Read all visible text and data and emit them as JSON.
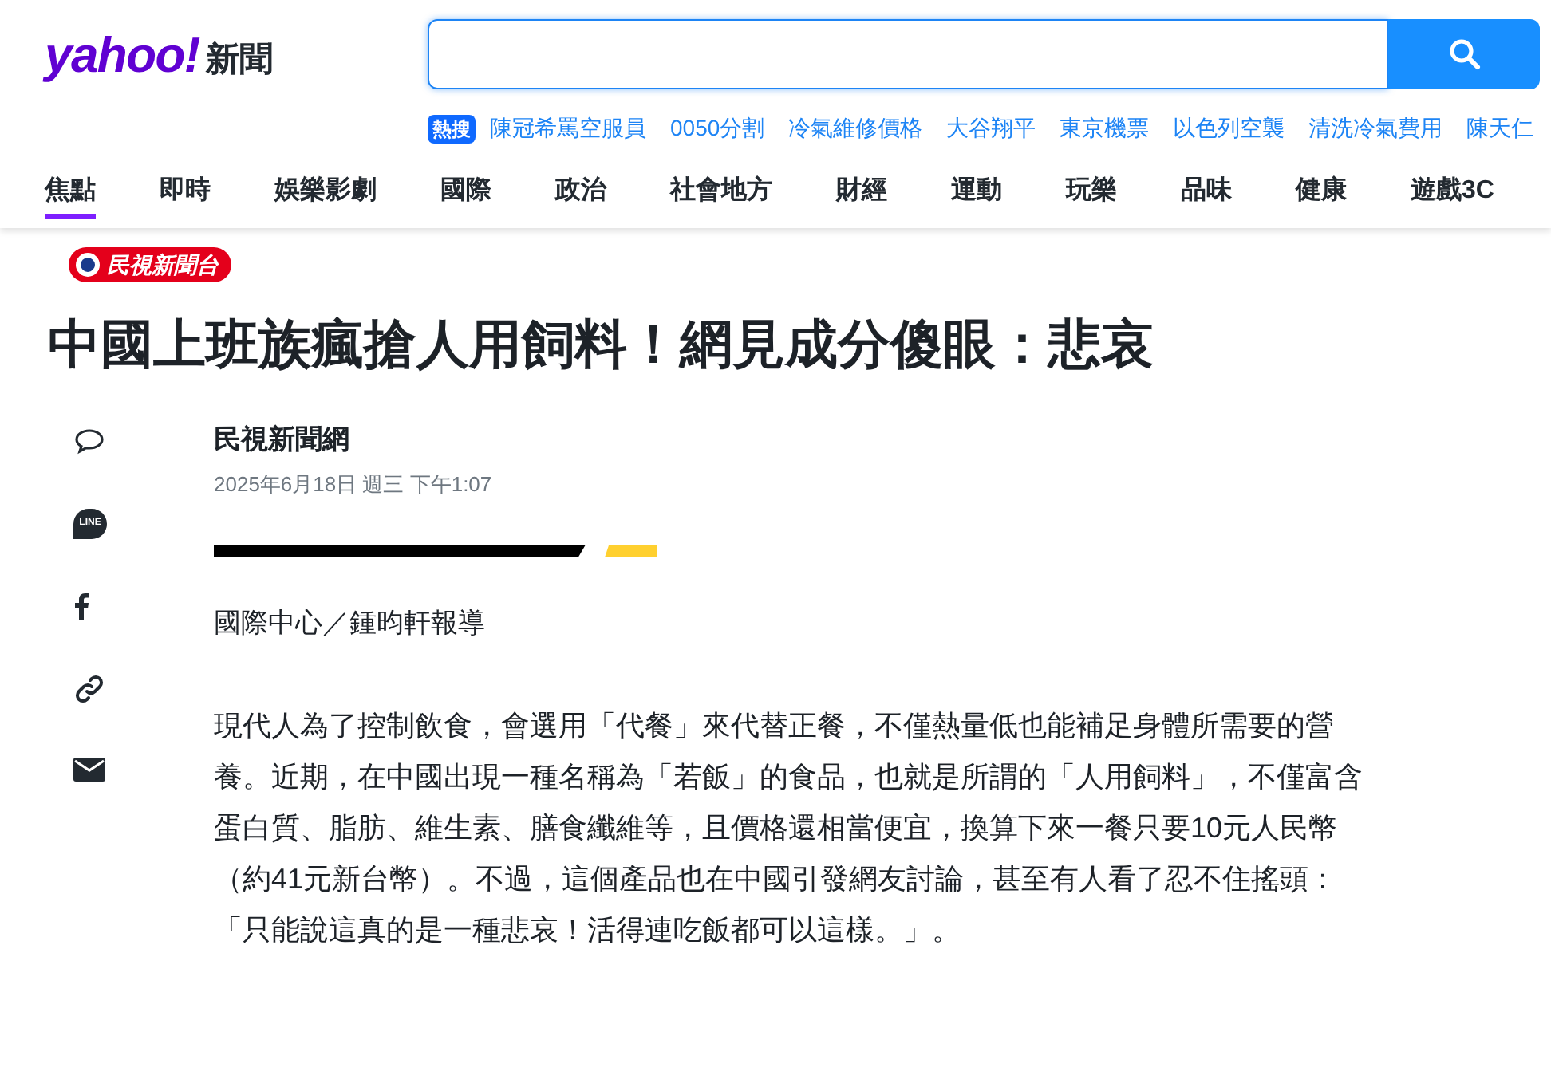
{
  "logo": {
    "wordmark": "yahoo!",
    "section": "新聞"
  },
  "trending": {
    "badge": "熱搜",
    "items": [
      "陳冠希罵空服員",
      "0050分割",
      "冷氣維修價格",
      "大谷翔平",
      "東京機票",
      "以色列空襲",
      "清洗冷氣費用",
      "陳天仁"
    ]
  },
  "nav": [
    {
      "label": "焦點",
      "selected": true
    },
    {
      "label": "即時",
      "selected": false
    },
    {
      "label": "娛樂影劇",
      "selected": false
    },
    {
      "label": "國際",
      "selected": false
    },
    {
      "label": "政治",
      "selected": false
    },
    {
      "label": "社會地方",
      "selected": false
    },
    {
      "label": "財經",
      "selected": false
    },
    {
      "label": "運動",
      "selected": false
    },
    {
      "label": "玩樂",
      "selected": false
    },
    {
      "label": "品味",
      "selected": false
    },
    {
      "label": "健康",
      "selected": false
    },
    {
      "label": "遊戲3C",
      "selected": false
    }
  ],
  "article": {
    "source_badge": "民視新聞台",
    "title": "中國上班族瘋搶人用飼料！網見成分傻眼：悲哀",
    "author": "民視新聞網",
    "date": "2025年6月18日 週三 下午1:07",
    "share": [
      {
        "kind": "comment"
      },
      {
        "kind": "line",
        "text": "LINE"
      },
      {
        "kind": "facebook"
      },
      {
        "kind": "link"
      },
      {
        "kind": "email"
      }
    ],
    "byline": "國際中心／鍾昀軒報導",
    "paragraphs": [
      "現代人為了控制飲食，會選用「代餐」來代替正餐，不僅熱量低也能補足身體所需要的營養。近期，在中國出現一種名稱為「若飯」的食品，也就是所謂的「人用飼料」，不僅富含蛋白質、脂肪、維生素、膳食纖維等，且價格還相當便宜，換算下來一餐只要10元人民幣（約41元新台幣）。不過，這個產品也在中國引發網友討論，甚至有人看了忍不住搖頭：「只能說這真的是一種悲哀！活得連吃飯都可以這樣。」。"
    ]
  }
}
